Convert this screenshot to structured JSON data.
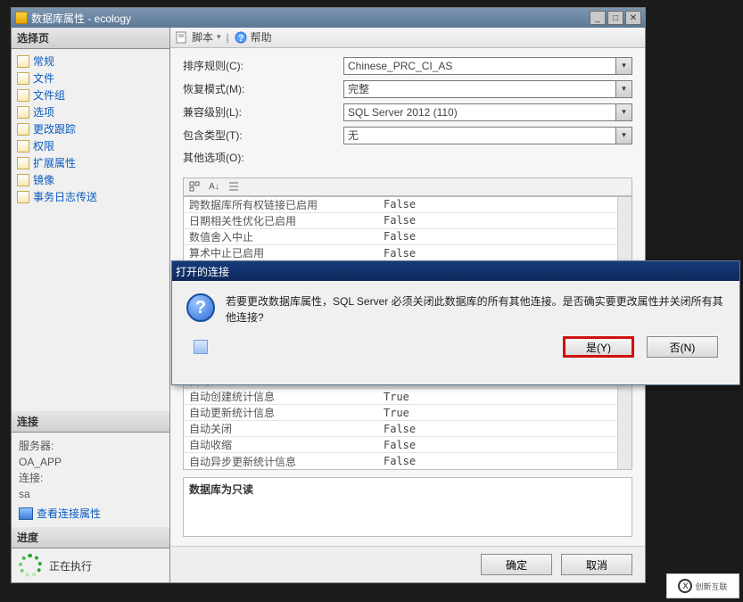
{
  "window": {
    "title": "数据库属性 - ecology"
  },
  "toolbar": {
    "script": "脚本",
    "help": "帮助"
  },
  "sidebar": {
    "select_page": "选择页",
    "items": [
      {
        "label": "常规"
      },
      {
        "label": "文件"
      },
      {
        "label": "文件组"
      },
      {
        "label": "选项"
      },
      {
        "label": "更改跟踪"
      },
      {
        "label": "权限"
      },
      {
        "label": "扩展属性"
      },
      {
        "label": "镜像"
      },
      {
        "label": "事务日志传送"
      }
    ],
    "connection_head": "连接",
    "server_label": "服务器:",
    "server_value": "OA_APP",
    "conn_label": "连接:",
    "conn_value": "sa",
    "view_conn": "查看连接属性",
    "progress_head": "进度",
    "progress_text": "正在执行"
  },
  "form": {
    "collation_label": "排序规则(C):",
    "collation_value": "Chinese_PRC_CI_AS",
    "recovery_label": "恢复模式(M):",
    "recovery_value": "完整",
    "compat_label": "兼容级别(L):",
    "compat_value": "SQL Server 2012 (110)",
    "containment_label": "包含类型(T):",
    "containment_value": "无",
    "other_label": "其他选项(O):"
  },
  "grid_top": [
    {
      "name": "跨数据库所有权链接已启用",
      "value": "False"
    },
    {
      "name": "日期相关性优化已启用",
      "value": "False"
    },
    {
      "name": "数值舍入中止",
      "value": "False"
    },
    {
      "name": "算术中止已启用",
      "value": "False"
    }
  ],
  "grid_cat": "自动",
  "grid_bottom": [
    {
      "name": "自动创建统计信息",
      "value": "True"
    },
    {
      "name": "自动更新统计信息",
      "value": "True"
    },
    {
      "name": "自动关闭",
      "value": "False"
    },
    {
      "name": "自动收缩",
      "value": "False"
    },
    {
      "name": "自动异步更新统计信息",
      "value": "False"
    }
  ],
  "readonly_label": "数据库为只读",
  "buttons": {
    "ok": "确定",
    "cancel": "取消"
  },
  "modal": {
    "title": "打开的连接",
    "message": "若要更改数据库属性，SQL Server 必须关闭此数据库的所有其他连接。是否确实要更改属性并关闭所有其他连接?",
    "yes": "是(Y)",
    "no": "否(N)"
  },
  "logo_text": "创新互联"
}
